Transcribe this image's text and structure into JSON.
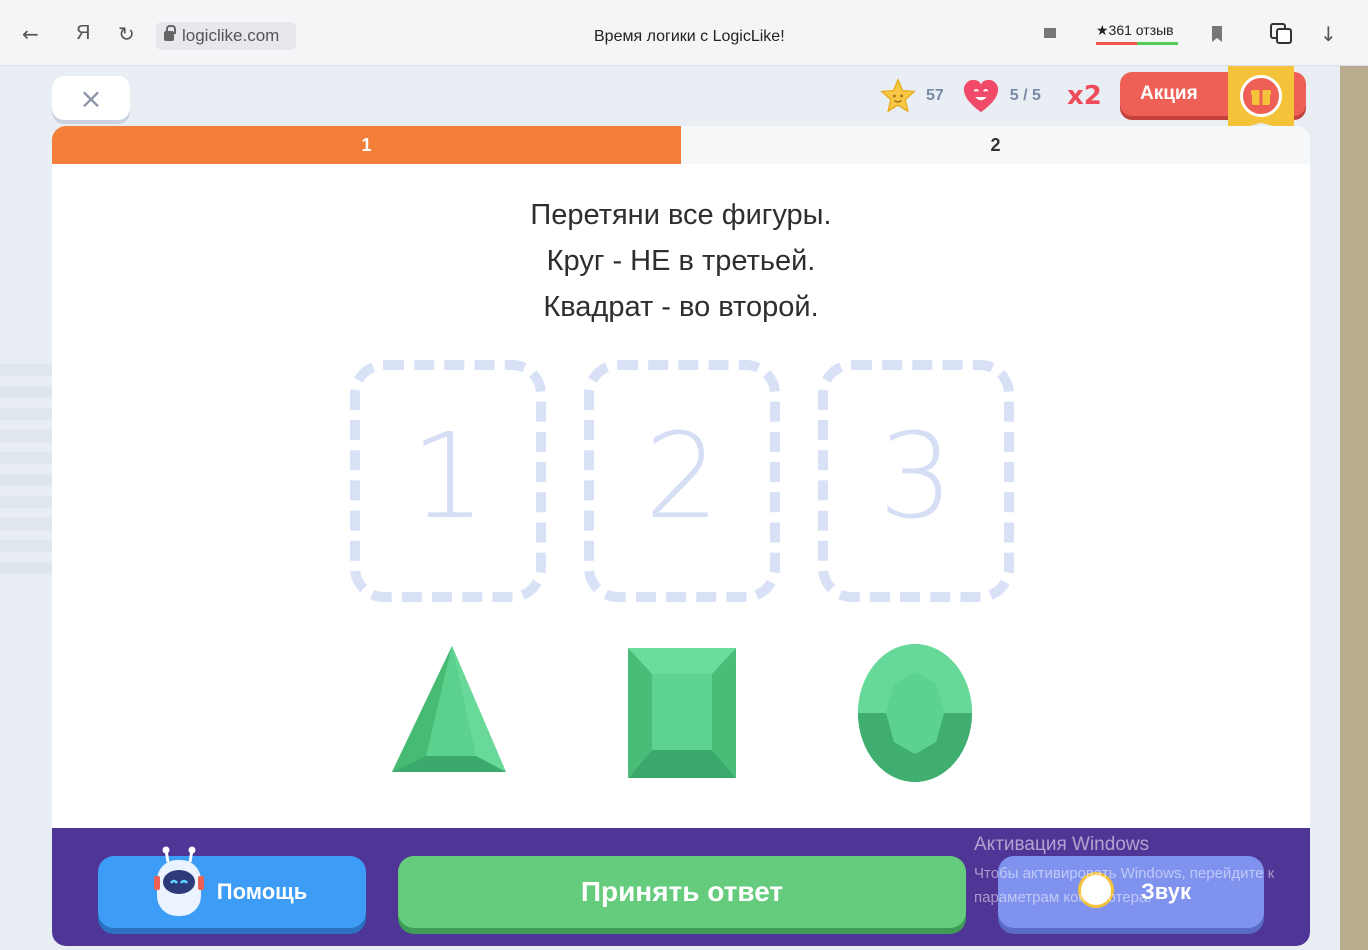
{
  "browser": {
    "back_glyph": "←",
    "yandex_glyph": "Я",
    "reload_glyph": "↻",
    "url": "logiclike.com",
    "tab_title": "Время логики с LogicLike!",
    "reviews": "★361 отзыв",
    "download_glyph": "↓"
  },
  "header": {
    "close_glyph": "×",
    "stars": "57",
    "lives": "5 / 5",
    "multiplier": "x2",
    "promo_label": "Акция"
  },
  "tabs": [
    {
      "label": "1",
      "active": true
    },
    {
      "label": "2",
      "active": false
    }
  ],
  "task": {
    "line1": "Перетяни все фигуры.",
    "line2": "Круг - НЕ в третьей.",
    "line3": "Квадрат - во второй."
  },
  "slots": [
    "1",
    "2",
    "3"
  ],
  "shapes": [
    "triangle",
    "square",
    "circle"
  ],
  "footer": {
    "help_label": "Помощь",
    "accept_label": "Принять ответ",
    "sound_label": "Звук"
  },
  "watermark": {
    "title": "Активация Windows",
    "text": "Чтобы активировать Windows, перейдите к параметрам компьютера."
  },
  "colors": {
    "tab_active": "#f37e39",
    "shape_green": "#5ad08a",
    "accept": "#66cc7d",
    "help": "#3d9cf5",
    "sound": "#7f92ee",
    "footer": "#4e3596"
  }
}
